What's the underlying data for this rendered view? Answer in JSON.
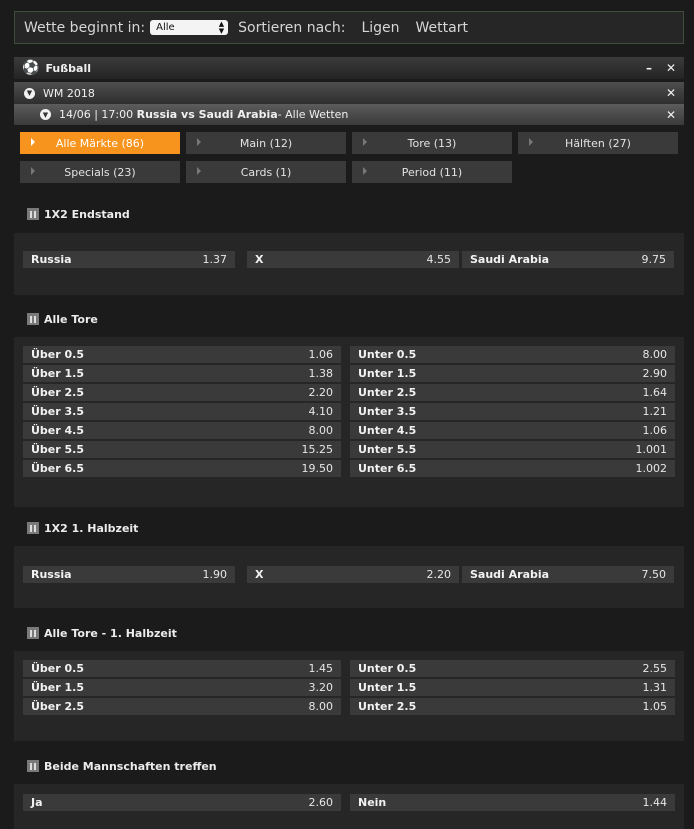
{
  "filter": {
    "begins_label": "Wette beginnt in:",
    "select_value": "Alle",
    "sort_label": "Sortieren nach:",
    "sort_leagues": "Ligen",
    "sort_bettype": "Wettart"
  },
  "sport": {
    "title": "Fußball"
  },
  "league": {
    "title": "WM 2018"
  },
  "match": {
    "date": "14/06 | 17:00",
    "teams": "Russia vs Saudi Arabia",
    "suffix": " - Alle Wetten"
  },
  "tabs": [
    {
      "label": "Alle Märkte (86)",
      "active": true
    },
    {
      "label": "Main (12)"
    },
    {
      "label": "Tore (13)"
    },
    {
      "label": "Hälften (27)"
    },
    {
      "label": "Specials (23)"
    },
    {
      "label": "Cards (1)"
    },
    {
      "label": "Period (11)"
    }
  ],
  "markets": {
    "x12": {
      "title": "1X2 Endstand",
      "home": "Russia",
      "home_odd": "1.37",
      "draw": "X",
      "draw_odd": "4.55",
      "away": "Saudi Arabia",
      "away_odd": "9.75"
    },
    "goals": {
      "title": "Alle Tore",
      "rows": [
        {
          "over": "Über 0.5",
          "over_odd": "1.06",
          "under": "Unter 0.5",
          "under_odd": "8.00"
        },
        {
          "over": "Über 1.5",
          "over_odd": "1.38",
          "under": "Unter 1.5",
          "under_odd": "2.90"
        },
        {
          "over": "Über 2.5",
          "over_odd": "2.20",
          "under": "Unter 2.5",
          "under_odd": "1.64"
        },
        {
          "over": "Über 3.5",
          "over_odd": "4.10",
          "under": "Unter 3.5",
          "under_odd": "1.21"
        },
        {
          "over": "Über 4.5",
          "over_odd": "8.00",
          "under": "Unter 4.5",
          "under_odd": "1.06"
        },
        {
          "over": "Über 5.5",
          "over_odd": "15.25",
          "under": "Unter 5.5",
          "under_odd": "1.001"
        },
        {
          "over": "Über 6.5",
          "over_odd": "19.50",
          "under": "Unter 6.5",
          "under_odd": "1.002"
        }
      ]
    },
    "x12_half": {
      "title": "1X2 1. Halbzeit",
      "home": "Russia",
      "home_odd": "1.90",
      "draw": "X",
      "draw_odd": "2.20",
      "away": "Saudi Arabia",
      "away_odd": "7.50"
    },
    "goals_half": {
      "title": "Alle Tore - 1. Halbzeit",
      "rows": [
        {
          "over": "Über 0.5",
          "over_odd": "1.45",
          "under": "Unter 0.5",
          "under_odd": "2.55"
        },
        {
          "over": "Über 1.5",
          "over_odd": "3.20",
          "under": "Unter 1.5",
          "under_odd": "1.31"
        },
        {
          "over": "Über 2.5",
          "over_odd": "8.00",
          "under": "Unter 2.5",
          "under_odd": "1.05"
        }
      ]
    },
    "btts": {
      "title": "Beide Mannschaften treffen",
      "yes": "Ja",
      "yes_odd": "2.60",
      "no": "Nein",
      "no_odd": "1.44"
    }
  }
}
